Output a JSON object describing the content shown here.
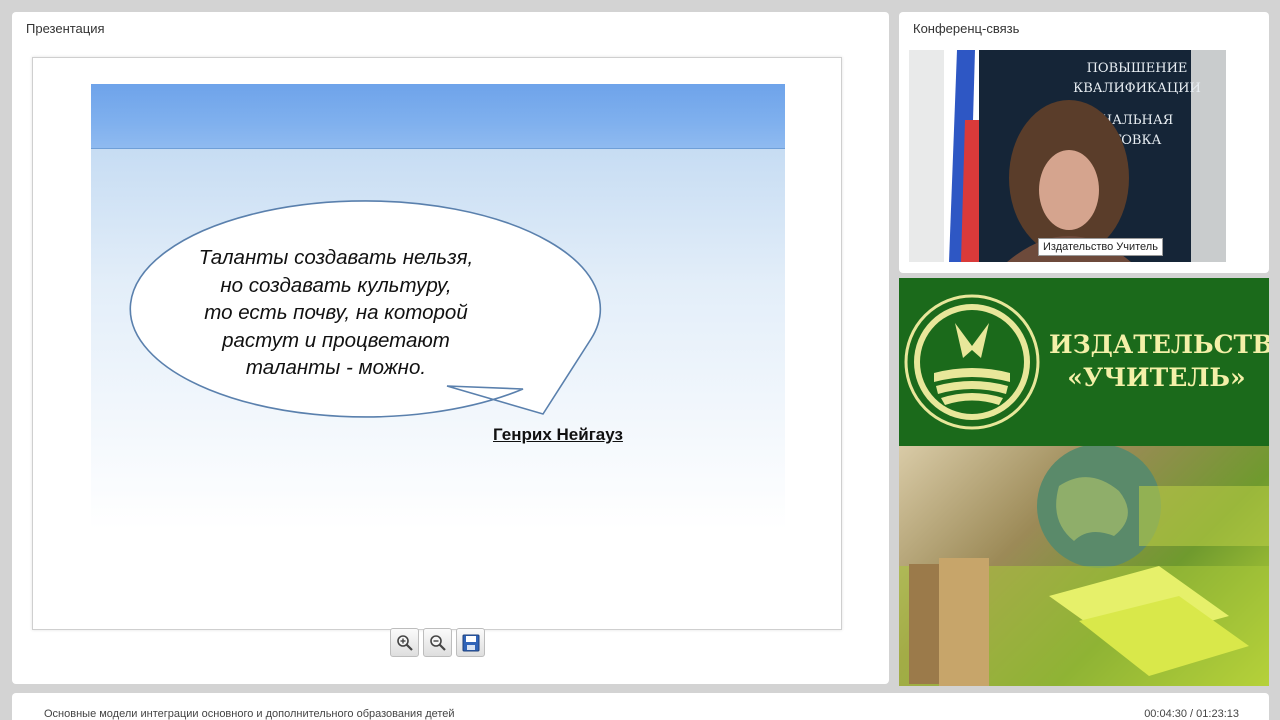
{
  "presentation": {
    "panel_title": "Презентация",
    "slide": {
      "quote_lines": [
        "Таланты создавать нельзя,",
        "но создавать культуру,",
        "то есть почву, на которой",
        "растут и процветают",
        "таланты - можно."
      ],
      "author": "Генрих Нейгауз"
    },
    "toolbar": {
      "zoom_in_icon": "zoom-in-icon",
      "zoom_out_icon": "zoom-out-icon",
      "save_icon": "save-icon"
    }
  },
  "conference": {
    "panel_title": "Конференц-связь",
    "participant_name": "Издательство Учитель",
    "background_poster_lines": [
      "ПОВЫШЕНИЕ",
      "КВАЛИФИКАЦИИ",
      "НАЛЬНАЯ",
      "ТОВКА"
    ]
  },
  "publisher_banner": {
    "title_line1": "ИЗДАТЕЛЬСТВО",
    "title_line2": "«УЧИТЕЛЬ»"
  },
  "footer": {
    "title": "Основные модели интеграции  основного и дополнительного образования детей",
    "time": "00:04:30 / 01:23:13"
  },
  "colors": {
    "slide_banner": "#7fb0ee",
    "bubble_stroke": "#5a80ad",
    "publisher_green": "#1b6a1b",
    "publisher_text": "#f4f0a8"
  }
}
